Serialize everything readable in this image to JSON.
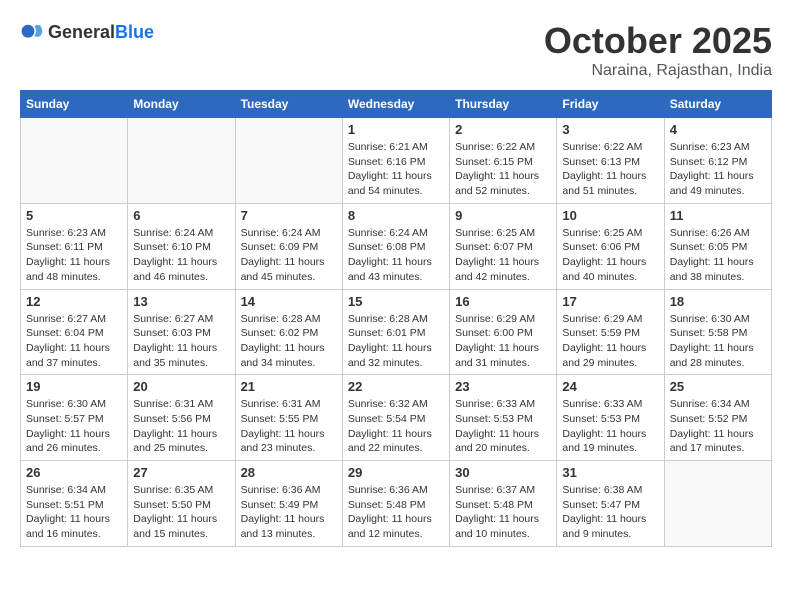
{
  "logo": {
    "text_general": "General",
    "text_blue": "Blue"
  },
  "calendar": {
    "title": "October 2025",
    "subtitle": "Naraina, Rajasthan, India",
    "weekdays": [
      "Sunday",
      "Monday",
      "Tuesday",
      "Wednesday",
      "Thursday",
      "Friday",
      "Saturday"
    ],
    "weeks": [
      [
        {
          "day": "",
          "sunrise": "",
          "sunset": "",
          "daylight": ""
        },
        {
          "day": "",
          "sunrise": "",
          "sunset": "",
          "daylight": ""
        },
        {
          "day": "",
          "sunrise": "",
          "sunset": "",
          "daylight": ""
        },
        {
          "day": "1",
          "sunrise": "Sunrise: 6:21 AM",
          "sunset": "Sunset: 6:16 PM",
          "daylight": "Daylight: 11 hours and 54 minutes."
        },
        {
          "day": "2",
          "sunrise": "Sunrise: 6:22 AM",
          "sunset": "Sunset: 6:15 PM",
          "daylight": "Daylight: 11 hours and 52 minutes."
        },
        {
          "day": "3",
          "sunrise": "Sunrise: 6:22 AM",
          "sunset": "Sunset: 6:13 PM",
          "daylight": "Daylight: 11 hours and 51 minutes."
        },
        {
          "day": "4",
          "sunrise": "Sunrise: 6:23 AM",
          "sunset": "Sunset: 6:12 PM",
          "daylight": "Daylight: 11 hours and 49 minutes."
        }
      ],
      [
        {
          "day": "5",
          "sunrise": "Sunrise: 6:23 AM",
          "sunset": "Sunset: 6:11 PM",
          "daylight": "Daylight: 11 hours and 48 minutes."
        },
        {
          "day": "6",
          "sunrise": "Sunrise: 6:24 AM",
          "sunset": "Sunset: 6:10 PM",
          "daylight": "Daylight: 11 hours and 46 minutes."
        },
        {
          "day": "7",
          "sunrise": "Sunrise: 6:24 AM",
          "sunset": "Sunset: 6:09 PM",
          "daylight": "Daylight: 11 hours and 45 minutes."
        },
        {
          "day": "8",
          "sunrise": "Sunrise: 6:24 AM",
          "sunset": "Sunset: 6:08 PM",
          "daylight": "Daylight: 11 hours and 43 minutes."
        },
        {
          "day": "9",
          "sunrise": "Sunrise: 6:25 AM",
          "sunset": "Sunset: 6:07 PM",
          "daylight": "Daylight: 11 hours and 42 minutes."
        },
        {
          "day": "10",
          "sunrise": "Sunrise: 6:25 AM",
          "sunset": "Sunset: 6:06 PM",
          "daylight": "Daylight: 11 hours and 40 minutes."
        },
        {
          "day": "11",
          "sunrise": "Sunrise: 6:26 AM",
          "sunset": "Sunset: 6:05 PM",
          "daylight": "Daylight: 11 hours and 38 minutes."
        }
      ],
      [
        {
          "day": "12",
          "sunrise": "Sunrise: 6:27 AM",
          "sunset": "Sunset: 6:04 PM",
          "daylight": "Daylight: 11 hours and 37 minutes."
        },
        {
          "day": "13",
          "sunrise": "Sunrise: 6:27 AM",
          "sunset": "Sunset: 6:03 PM",
          "daylight": "Daylight: 11 hours and 35 minutes."
        },
        {
          "day": "14",
          "sunrise": "Sunrise: 6:28 AM",
          "sunset": "Sunset: 6:02 PM",
          "daylight": "Daylight: 11 hours and 34 minutes."
        },
        {
          "day": "15",
          "sunrise": "Sunrise: 6:28 AM",
          "sunset": "Sunset: 6:01 PM",
          "daylight": "Daylight: 11 hours and 32 minutes."
        },
        {
          "day": "16",
          "sunrise": "Sunrise: 6:29 AM",
          "sunset": "Sunset: 6:00 PM",
          "daylight": "Daylight: 11 hours and 31 minutes."
        },
        {
          "day": "17",
          "sunrise": "Sunrise: 6:29 AM",
          "sunset": "Sunset: 5:59 PM",
          "daylight": "Daylight: 11 hours and 29 minutes."
        },
        {
          "day": "18",
          "sunrise": "Sunrise: 6:30 AM",
          "sunset": "Sunset: 5:58 PM",
          "daylight": "Daylight: 11 hours and 28 minutes."
        }
      ],
      [
        {
          "day": "19",
          "sunrise": "Sunrise: 6:30 AM",
          "sunset": "Sunset: 5:57 PM",
          "daylight": "Daylight: 11 hours and 26 minutes."
        },
        {
          "day": "20",
          "sunrise": "Sunrise: 6:31 AM",
          "sunset": "Sunset: 5:56 PM",
          "daylight": "Daylight: 11 hours and 25 minutes."
        },
        {
          "day": "21",
          "sunrise": "Sunrise: 6:31 AM",
          "sunset": "Sunset: 5:55 PM",
          "daylight": "Daylight: 11 hours and 23 minutes."
        },
        {
          "day": "22",
          "sunrise": "Sunrise: 6:32 AM",
          "sunset": "Sunset: 5:54 PM",
          "daylight": "Daylight: 11 hours and 22 minutes."
        },
        {
          "day": "23",
          "sunrise": "Sunrise: 6:33 AM",
          "sunset": "Sunset: 5:53 PM",
          "daylight": "Daylight: 11 hours and 20 minutes."
        },
        {
          "day": "24",
          "sunrise": "Sunrise: 6:33 AM",
          "sunset": "Sunset: 5:53 PM",
          "daylight": "Daylight: 11 hours and 19 minutes."
        },
        {
          "day": "25",
          "sunrise": "Sunrise: 6:34 AM",
          "sunset": "Sunset: 5:52 PM",
          "daylight": "Daylight: 11 hours and 17 minutes."
        }
      ],
      [
        {
          "day": "26",
          "sunrise": "Sunrise: 6:34 AM",
          "sunset": "Sunset: 5:51 PM",
          "daylight": "Daylight: 11 hours and 16 minutes."
        },
        {
          "day": "27",
          "sunrise": "Sunrise: 6:35 AM",
          "sunset": "Sunset: 5:50 PM",
          "daylight": "Daylight: 11 hours and 15 minutes."
        },
        {
          "day": "28",
          "sunrise": "Sunrise: 6:36 AM",
          "sunset": "Sunset: 5:49 PM",
          "daylight": "Daylight: 11 hours and 13 minutes."
        },
        {
          "day": "29",
          "sunrise": "Sunrise: 6:36 AM",
          "sunset": "Sunset: 5:48 PM",
          "daylight": "Daylight: 11 hours and 12 minutes."
        },
        {
          "day": "30",
          "sunrise": "Sunrise: 6:37 AM",
          "sunset": "Sunset: 5:48 PM",
          "daylight": "Daylight: 11 hours and 10 minutes."
        },
        {
          "day": "31",
          "sunrise": "Sunrise: 6:38 AM",
          "sunset": "Sunset: 5:47 PM",
          "daylight": "Daylight: 11 hours and 9 minutes."
        },
        {
          "day": "",
          "sunrise": "",
          "sunset": "",
          "daylight": ""
        }
      ]
    ]
  }
}
